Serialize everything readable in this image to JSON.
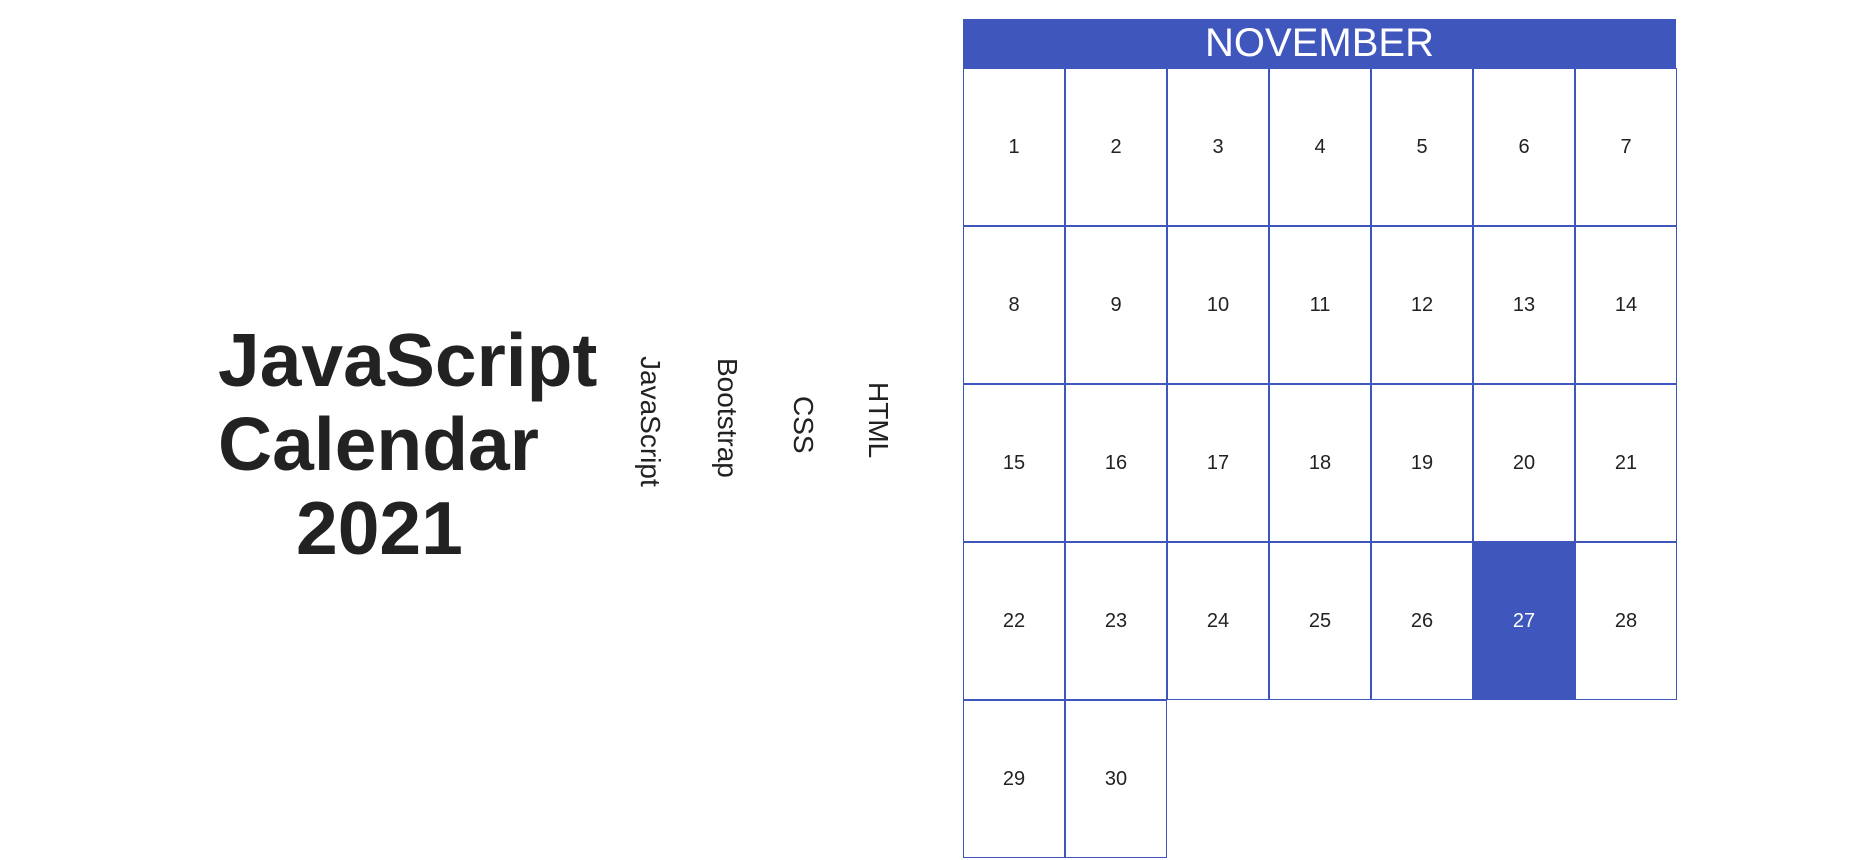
{
  "title": {
    "line1": "JavaScript",
    "line2": "Calendar",
    "line3": "2021"
  },
  "tags": [
    "JavaScript",
    "Bootstrap",
    "CSS",
    "HTML"
  ],
  "calendar": {
    "month": "NOVEMBER",
    "days": [
      "1",
      "2",
      "3",
      "4",
      "5",
      "6",
      "7",
      "8",
      "9",
      "10",
      "11",
      "12",
      "13",
      "14",
      "15",
      "16",
      "17",
      "18",
      "19",
      "20",
      "21",
      "22",
      "23",
      "24",
      "25",
      "26",
      "27",
      "28",
      "29",
      "30"
    ],
    "highlighted_day": "27"
  },
  "colors": {
    "accent": "#3f56bd",
    "text": "#222222",
    "background": "#ffffff"
  }
}
